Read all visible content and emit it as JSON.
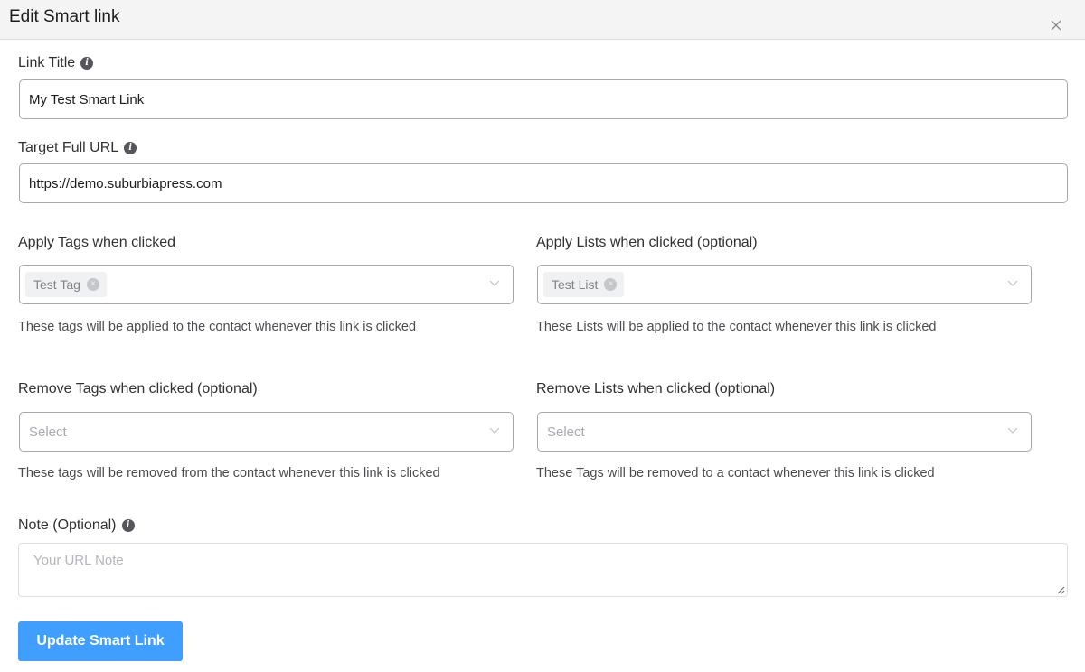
{
  "dialog": {
    "title": "Edit Smart link",
    "close_icon": "close-icon"
  },
  "fields": {
    "link_title": {
      "label": "Link Title",
      "icon": "info-icon",
      "value": "My Test Smart Link"
    },
    "target_url": {
      "label": "Target Full URL",
      "icon": "info-icon",
      "value": "https://demo.suburbiapress.com"
    },
    "apply_tags": {
      "label": "Apply Tags when clicked",
      "selected": [
        "Test Tag"
      ],
      "help": "These tags will be applied to the contact whenever this link is clicked"
    },
    "apply_lists": {
      "label": "Apply Lists when clicked (optional)",
      "selected": [
        "Test List"
      ],
      "help": "These Lists will be applied to the contact whenever this link is clicked"
    },
    "remove_tags": {
      "label": "Remove Tags when clicked (optional)",
      "placeholder": "Select",
      "help": "These tags will be removed from the contact whenever this link is clicked"
    },
    "remove_lists": {
      "label": "Remove Lists when clicked (optional)",
      "placeholder": "Select",
      "help": "These Tags will be removed to a contact whenever this link is clicked"
    },
    "note": {
      "label": "Note (Optional)",
      "icon": "info-icon",
      "placeholder": "Your URL Note",
      "value": ""
    }
  },
  "actions": {
    "submit_label": "Update Smart Link",
    "submit_color": "#409eff"
  },
  "icons": {
    "info_glyph": "i",
    "tag_remove_glyph": "×"
  }
}
